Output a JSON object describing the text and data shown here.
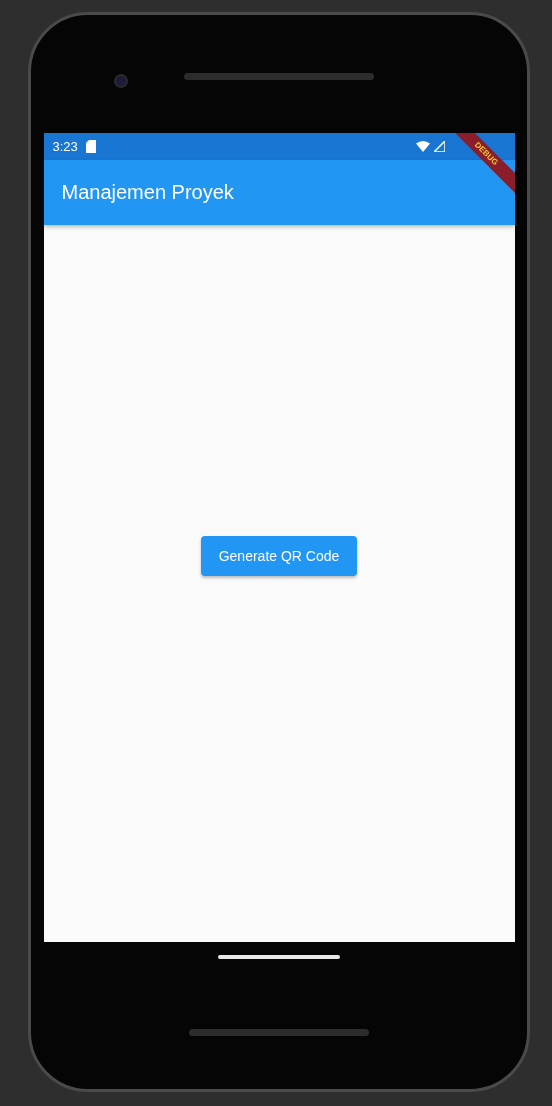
{
  "status_bar": {
    "time": "3:23"
  },
  "debug_banner": "DEBUG",
  "app_bar": {
    "title": "Manajemen Proyek"
  },
  "button": {
    "label": "Generate QR Code"
  }
}
